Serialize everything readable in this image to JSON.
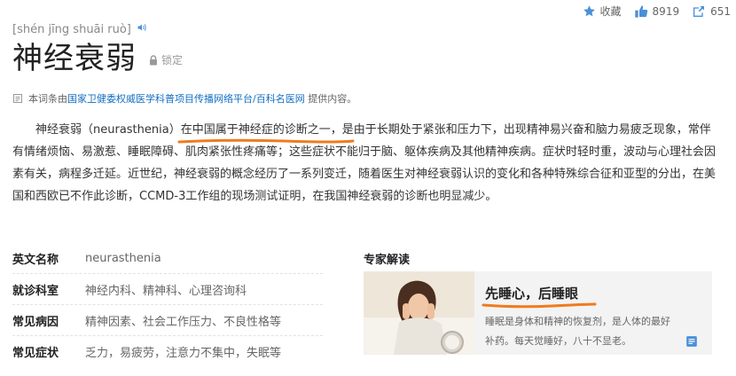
{
  "topbar": {
    "collect_label": "收藏",
    "like_count": "8919",
    "share_count": "651"
  },
  "header": {
    "pinyin": "[shén jīng shuāi ruò]",
    "title": "神经衰弱",
    "lock_label": "锁定"
  },
  "source": {
    "prefix": "本词条由",
    "org": "国家卫健委权威医学科普项目传播网络平台/百科名医网",
    "suffix": " 提供内容。"
  },
  "intro": {
    "part1": "神经衰弱（neurasthenia）",
    "highlight": "在中国属于神经症的诊断之一",
    "part2": "，是由于长期处于紧张和压力下，出现精神易兴奋和脑力易疲乏现象，常伴有情绪烦恼、易激惹、睡眠障碍、肌肉紧张性疼痛等；这些症状不能归于脑、躯体疾病及其他精神疾病。症状时轻时重，波动与心理社会因素有关，病程多迁延。近世纪，神经衰弱的概念经历了一系列变迁，随着医生对神经衰弱认识的变化和各种特殊综合征和亚型的分出，在美国和西欧已不作此诊断，CCMD-3工作组的现场测试证明，在我国神经衰弱的诊断也明显减少。"
  },
  "info": [
    {
      "label": "英文名称",
      "value": "neurasthenia"
    },
    {
      "label": "就诊科室",
      "value": "神经内科、精神科、心理咨询科"
    },
    {
      "label": "常见病因",
      "value": "精神因素、社会工作压力、不良性格等"
    },
    {
      "label": "常见症状",
      "value": "乏力，易疲劳，注意力不集中，失眠等"
    }
  ],
  "expert": {
    "section_title": "专家解读",
    "headline": "先睡心，后睡眼",
    "desc_line1": "睡眠是身体和精神的恢复剂，是人体的最好",
    "desc_line2": "补药。每天觉睡好，八十不显老。"
  },
  "colors": {
    "link": "#136ec2",
    "icon_blue": "#4a90d9",
    "annotation_orange": "#f07b1e"
  },
  "icons": [
    "star-icon",
    "thumb-up-icon",
    "share-icon",
    "speaker-icon",
    "lock-icon",
    "document-icon",
    "note-icon"
  ]
}
